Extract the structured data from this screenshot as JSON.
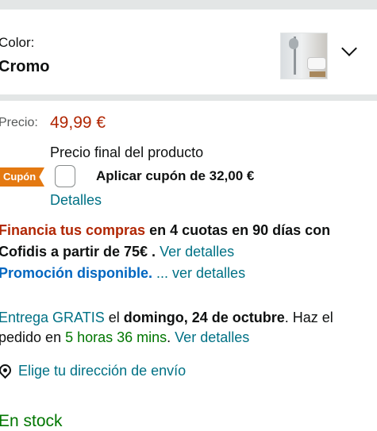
{
  "color_selector": {
    "label": "Color:",
    "value": "Cromo",
    "thumbnail_icon": "shower-product-thumbnail",
    "expand_icon": "chevron-down-icon"
  },
  "price": {
    "label": "Precio:",
    "value": "49,99 €",
    "final_note": "Precio final del producto"
  },
  "coupon": {
    "badge": "Cupón",
    "text": "Aplicar cupón de 32,00 €",
    "details_link": "Detalles"
  },
  "finance": {
    "highlight": "Financia tus compras",
    "text_rest": " en 4 cuotas en 90 días con",
    "line2_bold": "Cofidis a partir de 75€ .",
    "line2_link": " Ver detalles",
    "promo_bold": "Promoción disponible.",
    "promo_link": " ... ver detalles"
  },
  "delivery": {
    "free_link": "Entrega GRATIS",
    "el": " el ",
    "date": "domingo, 24 de octubre",
    "haz_el": ". Haz el",
    "pedido_en": "pedido en ",
    "countdown": "5 horas 36 mins",
    "period": ".",
    "details_link": " Ver detalles"
  },
  "address": {
    "link": "Elige tu dirección de envío",
    "icon": "location-pin-icon"
  },
  "stock": {
    "status": "En stock"
  },
  "colors": {
    "price_red": "#b12704",
    "link_teal": "#007185",
    "promo_blue": "#0066c0",
    "stock_green": "#007600",
    "coupon_orange": "#e47911",
    "divider": "#e3e6e6"
  }
}
